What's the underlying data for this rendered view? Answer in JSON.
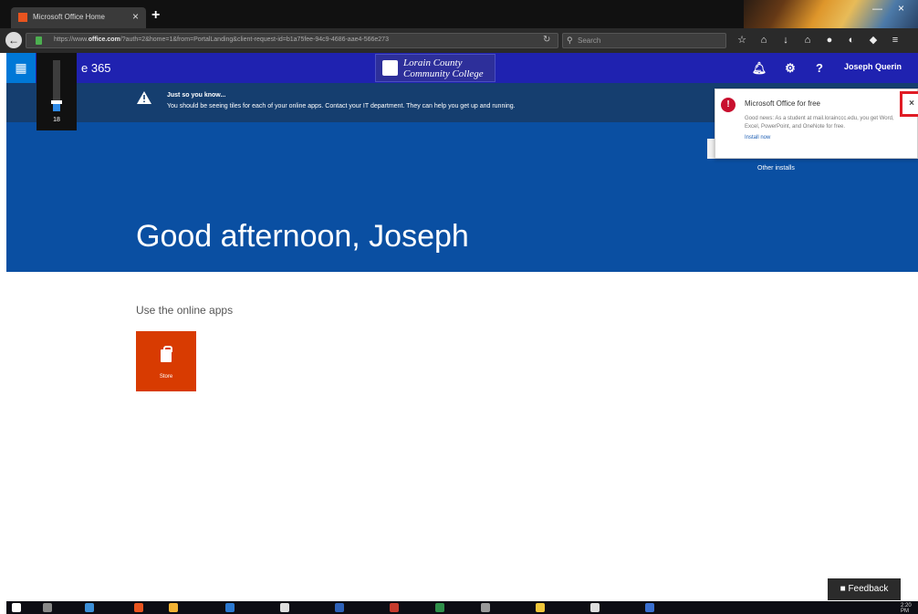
{
  "browser": {
    "tab_title": "Microsoft Office Home",
    "url_prefix": "https://www.",
    "url_domain": "office.com",
    "url_rest": "/?auth=2&home=1&from=PortalLanding&client-request-id=b1a75fee-94c9-4686-aae4-566e273",
    "search_placeholder": "Search"
  },
  "header": {
    "brand_suffix": "e 365",
    "logo_line1": "Lorain County",
    "logo_line2": "Community College",
    "user_name": "Joseph Querin",
    "help_label": "?"
  },
  "volume": {
    "level_text": "18",
    "level_fraction": 0.18
  },
  "notice": {
    "title": "Just so you know...",
    "body": "You should be seeing tiles for each of your online apps. Contact your IT department. They can help you get up and running."
  },
  "hero": {
    "greeting": "Good afternoon, Joseph",
    "other_installs": "Other installs"
  },
  "popup": {
    "title": "Microsoft Office for free",
    "body": "Good news: As a student at mail.lorainccc.edu, you get Word, Excel, PowerPoint, and OneNote for free.",
    "link": "Install now",
    "close": "×"
  },
  "content": {
    "section_label": "Use the online apps",
    "tile_label": "Store"
  },
  "feedback_label": "Feedback",
  "taskbar": {
    "clock": "2:20 PM"
  },
  "colors": {
    "office_header": "#1f22b0",
    "notice_bar": "#153e6f",
    "hero": "#0a4fa2",
    "store_tile": "#d83b01",
    "close_highlight": "#e01b24"
  }
}
